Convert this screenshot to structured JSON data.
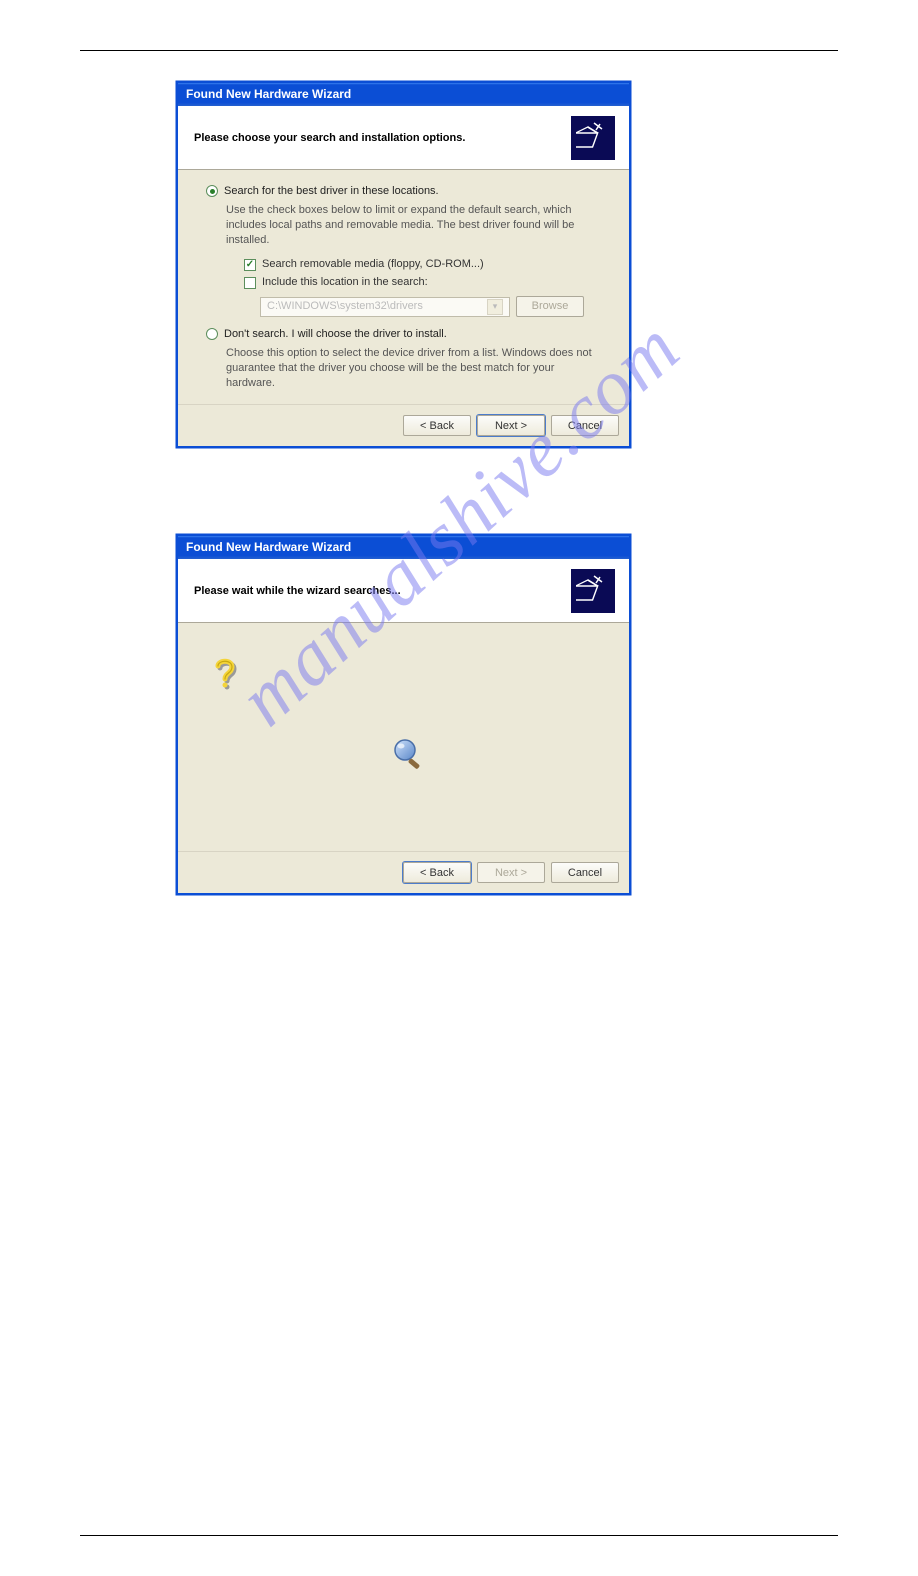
{
  "watermark": "manualshive.com",
  "dialog1": {
    "title": "Found New Hardware Wizard",
    "header": "Please choose your search and installation options.",
    "radio1": {
      "label": "Search for the best driver in these locations.",
      "desc": "Use the check boxes below to limit or expand the default search, which includes local paths and removable media. The best driver found will be installed.",
      "checked": true
    },
    "check1": {
      "label": "Search removable media (floppy, CD-ROM...)",
      "checked": true
    },
    "check2": {
      "label": "Include this location in the search:",
      "checked": false
    },
    "path_input": "C:\\WINDOWS\\system32\\drivers",
    "browse_label": "Browse",
    "radio2": {
      "label": "Don't search. I will choose the driver to install.",
      "desc": "Choose this option to select the device driver from a list.  Windows does not guarantee that the driver you choose will be the best match for your hardware.",
      "checked": false
    },
    "back_label": "< Back",
    "next_label": "Next >",
    "cancel_label": "Cancel"
  },
  "dialog2": {
    "title": "Found New Hardware Wizard",
    "header": "Please wait while the wizard searches...",
    "back_label": "< Back",
    "next_label": "Next >",
    "cancel_label": "Cancel"
  }
}
